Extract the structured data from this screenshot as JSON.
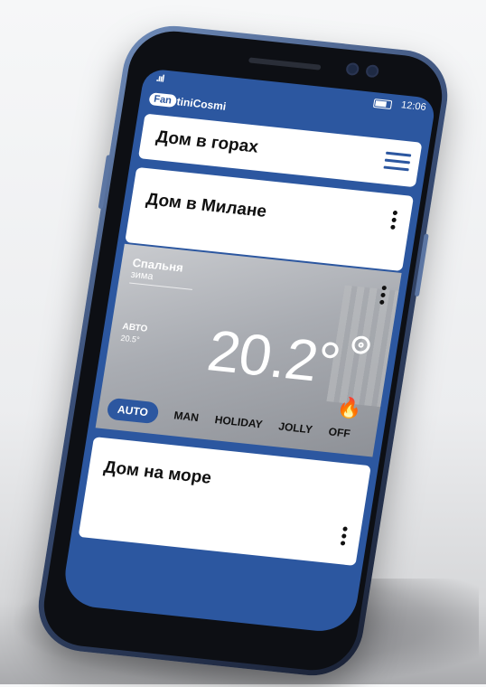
{
  "status_bar": {
    "signal": ".ııl",
    "time": "12:06"
  },
  "brand": {
    "badge": "Fan",
    "name": "tiniCosmi"
  },
  "homes": [
    {
      "title": "Дом в горах"
    },
    {
      "title": "Дом в Милане"
    },
    {
      "title": "Дом на море"
    }
  ],
  "room": {
    "name": "Спальня",
    "season": "зима",
    "mode_label": "АВТО",
    "setpoint": "20.5°",
    "temperature": "20.2°"
  },
  "modes": [
    "AUTO",
    "MAN",
    "HOLIDAY",
    "JOLLY",
    "OFF"
  ],
  "active_mode": "AUTO",
  "colors": {
    "accent": "#2c57a0",
    "frame": "#5c76a3"
  }
}
